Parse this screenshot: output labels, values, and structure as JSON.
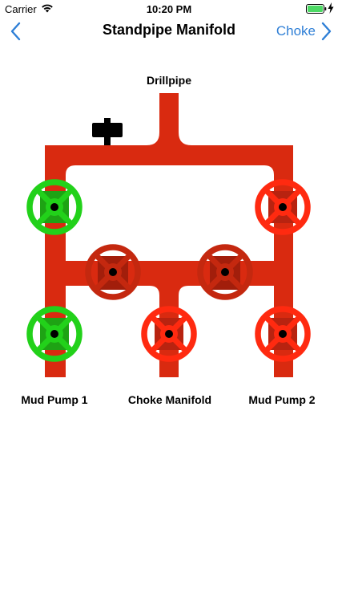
{
  "status_bar": {
    "carrier": "Carrier",
    "time": "10:20 PM",
    "icons": [
      "wifi-icon",
      "battery-icon",
      "charging-bolt-icon"
    ],
    "battery_color": "#4cd964"
  },
  "nav": {
    "title": "Standpipe Manifold",
    "forward_label": "Choke",
    "back_icon": "chevron-left-icon",
    "forward_icon": "chevron-right-icon",
    "accent_color": "#2f7fd6"
  },
  "manifold": {
    "labels": {
      "drillpipe": "Drillpipe",
      "mud_pump_1": "Mud Pump 1",
      "choke_manifold": "Choke Manifold",
      "mud_pump_2": "Mud Pump 2"
    },
    "pipe_color": "#d92a10",
    "valves": [
      {
        "name": "valve-upper-left",
        "state": "open",
        "color": "#22d11a"
      },
      {
        "name": "valve-upper-right",
        "state": "closed",
        "color": "#ff2a10"
      },
      {
        "name": "valve-center-left",
        "state": "closed",
        "color": "#c4280f"
      },
      {
        "name": "valve-center-right",
        "state": "closed",
        "color": "#c4280f"
      },
      {
        "name": "valve-mud-pump-1",
        "state": "open",
        "color": "#22d11a"
      },
      {
        "name": "valve-choke-manifold",
        "state": "closed",
        "color": "#ff2a10"
      },
      {
        "name": "valve-mud-pump-2",
        "state": "closed",
        "color": "#ff2a10"
      }
    ]
  }
}
